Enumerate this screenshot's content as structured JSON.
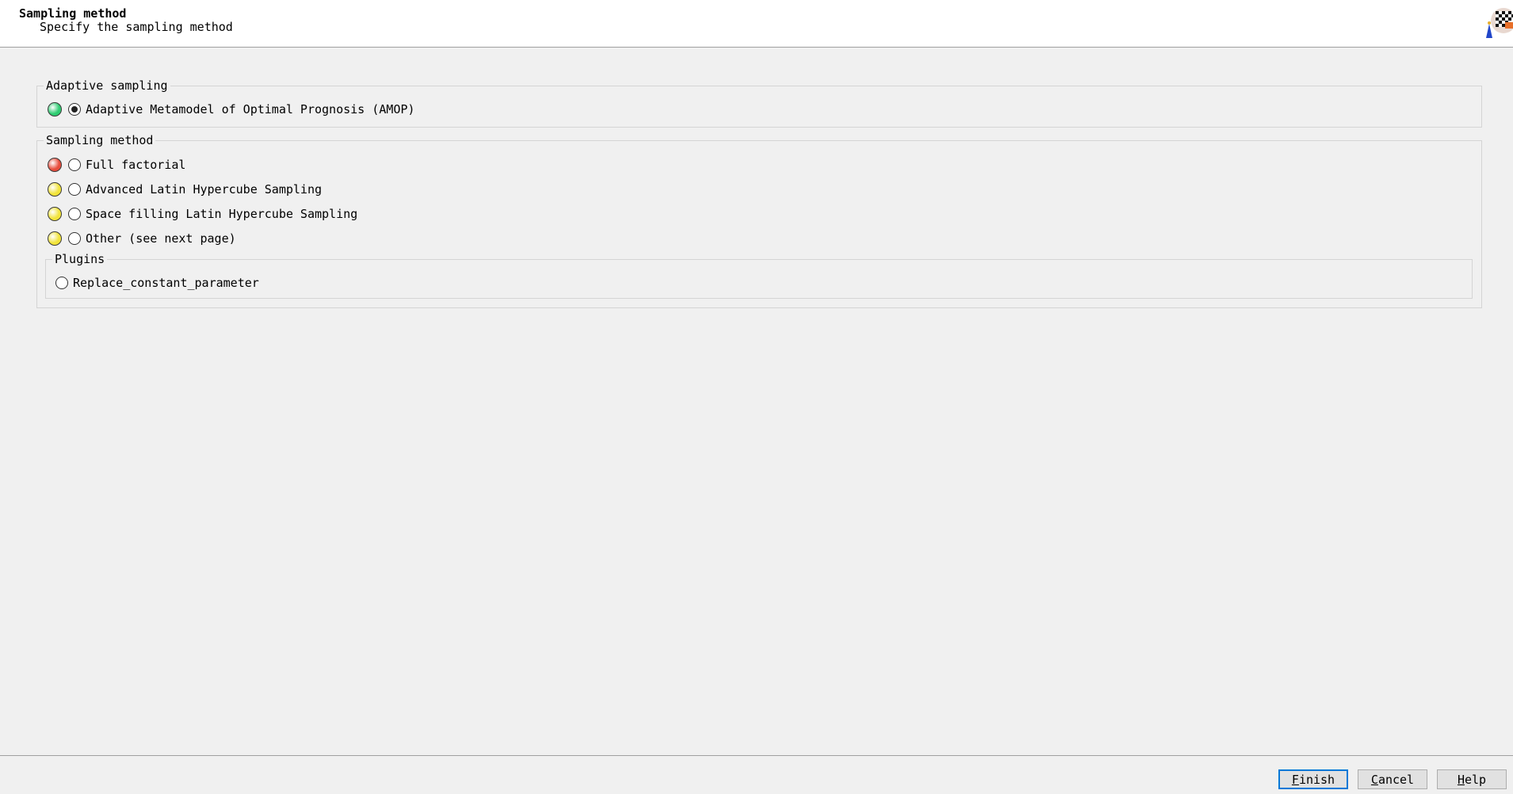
{
  "header": {
    "title": "Sampling method",
    "subtitle": "Specify the sampling method",
    "logo_icon": "wizard-checkered-flag-icon"
  },
  "adaptive_group": {
    "title": "Adaptive sampling",
    "options": [
      {
        "label": "Adaptive Metamodel of Optimal Prognosis (AMOP)",
        "status_color": "#2ecc71",
        "selected": true
      }
    ]
  },
  "sampling_group": {
    "title": "Sampling method",
    "options": [
      {
        "label": "Full factorial",
        "status_color": "#e74c3c",
        "selected": false
      },
      {
        "label": "Advanced Latin Hypercube Sampling",
        "status_color": "#f1e33a",
        "selected": false
      },
      {
        "label": "Space filling Latin Hypercube Sampling",
        "status_color": "#f1e33a",
        "selected": false
      },
      {
        "label": "Other (see next page)",
        "status_color": "#f1e33a",
        "selected": false
      }
    ],
    "plugins": {
      "title": "Plugins",
      "options": [
        {
          "label": "Replace_constant_parameter",
          "selected": false
        }
      ]
    }
  },
  "footer": {
    "finish_label": "Finish",
    "cancel_label": "Cancel",
    "help_label": "Help"
  }
}
